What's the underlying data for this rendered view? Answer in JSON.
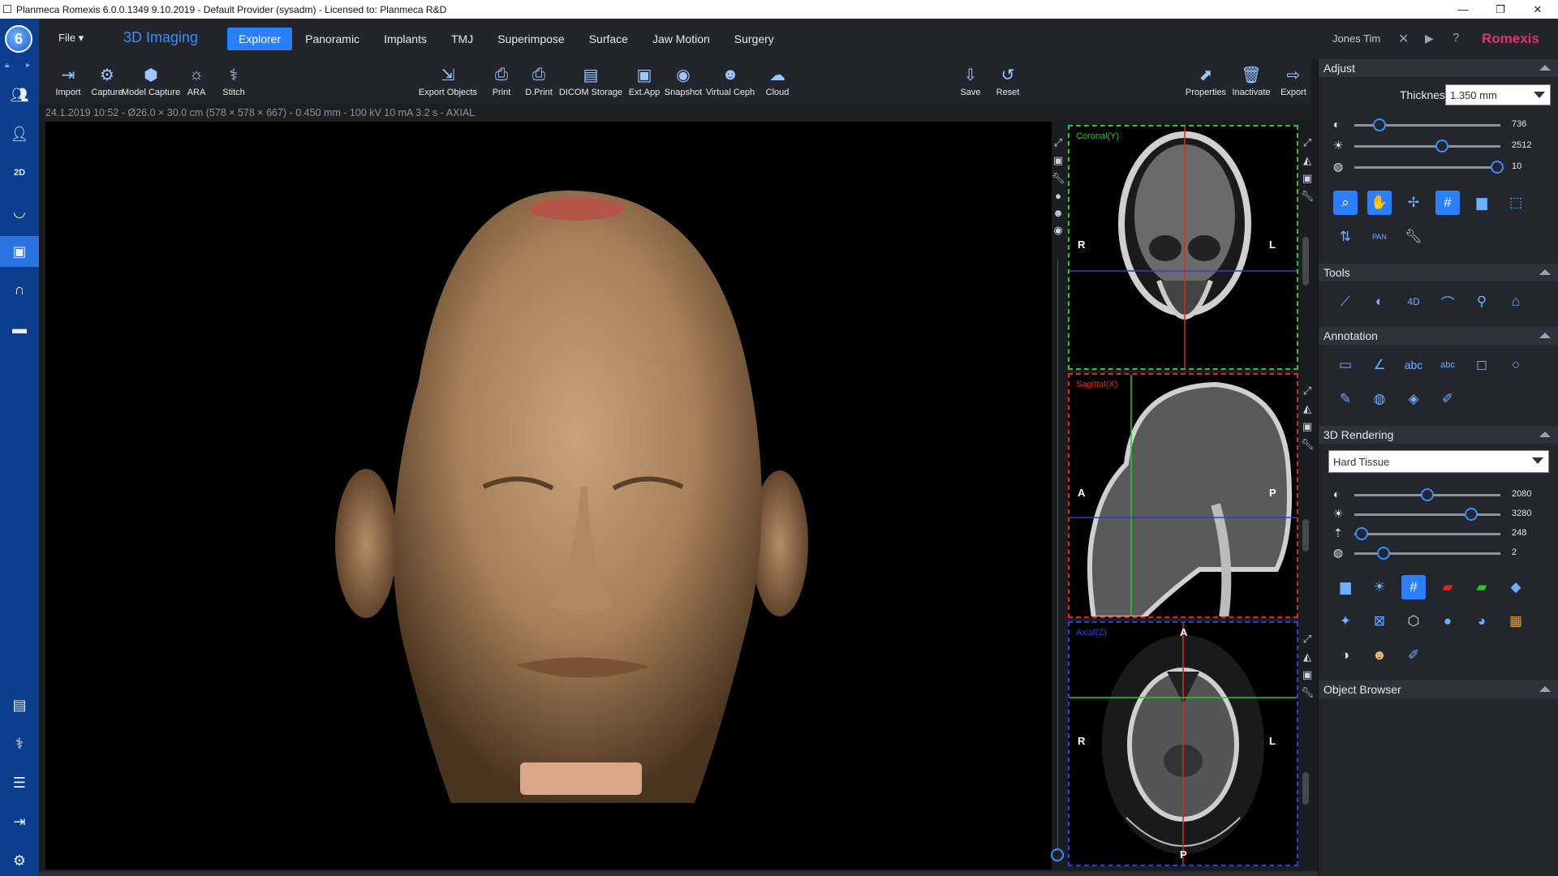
{
  "titlebar": {
    "title": "Planmeca Romexis 6.0.0.1349 9.10.2019 - Default Provider (sysadm) - Licensed to: Planmeca R&D",
    "minimize": "—",
    "maximize": "❐",
    "close": "✕"
  },
  "menubar": {
    "file": "File",
    "mode_title": "3D Imaging",
    "tabs": [
      "Explorer",
      "Panoramic",
      "Implants",
      "TMJ",
      "Superimpose",
      "Surface",
      "Jaw Motion",
      "Surgery"
    ],
    "active_tab": "Explorer",
    "user": "Jones  Tim",
    "brand": "Romexis"
  },
  "toolbar": {
    "left": [
      {
        "label": "Import",
        "icon": "import-icon"
      },
      {
        "label": "Capture",
        "icon": "capture-icon"
      },
      {
        "label": "Model Capture",
        "icon": "model-capture-icon"
      },
      {
        "label": "ARA",
        "icon": "ara-icon"
      },
      {
        "label": "Stitch",
        "icon": "stitch-icon"
      }
    ],
    "middle": [
      {
        "label": "Export Objects",
        "icon": "export-objects-icon"
      },
      {
        "label": "Print",
        "icon": "print-icon"
      },
      {
        "label": "D.Print",
        "icon": "dprint-icon"
      },
      {
        "label": "DICOM Storage",
        "icon": "dicom-storage-icon"
      },
      {
        "label": "Ext.App",
        "icon": "ext-app-icon"
      },
      {
        "label": "Snapshot",
        "icon": "snapshot-icon"
      },
      {
        "label": "Virtual Ceph",
        "icon": "virtual-ceph-icon"
      },
      {
        "label": "Cloud",
        "icon": "cloud-icon"
      }
    ],
    "save": [
      {
        "label": "Save",
        "icon": "save-icon"
      },
      {
        "label": "Reset",
        "icon": "reset-icon"
      }
    ],
    "right": [
      {
        "label": "Properties",
        "icon": "properties-icon"
      },
      {
        "label": "Inactivate",
        "icon": "inactivate-icon"
      },
      {
        "label": "Export",
        "icon": "export-icon"
      }
    ]
  },
  "info_line": "24.1.2019 10:52 - Ø26.0 × 30.0 cm (578 × 578 × 667) - 0.450 mm - 100 kV 10 mA 3.2 s - AXIAL",
  "slices": {
    "coronal": {
      "label": "Coronal(Y)",
      "left": "R",
      "right": "L",
      "color": "#22cc22"
    },
    "sagittal": {
      "label": "Sagittal(X)",
      "left": "A",
      "right": "P",
      "color": "#e02424"
    },
    "axial": {
      "label": "Axial(Z)",
      "top": "A",
      "bottom": "P",
      "left": "R",
      "right": "L",
      "color": "#2a3fe0"
    }
  },
  "panel": {
    "adjust": {
      "title": "Adjust",
      "thickness_label": "Thickness",
      "thickness_value": "1.350 mm",
      "sliders": [
        {
          "icon": "contrast-icon",
          "value": "736",
          "pos": 0.17
        },
        {
          "icon": "brightness-icon",
          "value": "2512",
          "pos": 0.6
        },
        {
          "icon": "sharpness-icon",
          "value": "10",
          "pos": 0.98
        }
      ]
    },
    "tools": {
      "title": "Tools"
    },
    "annotation": {
      "title": "Annotation"
    },
    "rendering": {
      "title": "3D Rendering",
      "preset": "Hard Tissue",
      "sliders": [
        {
          "icon": "contrast-icon",
          "value": "2080",
          "pos": 0.5
        },
        {
          "icon": "brightness-icon",
          "value": "3280",
          "pos": 0.8
        },
        {
          "icon": "threshold-icon",
          "value": "248",
          "pos": 0.05
        },
        {
          "icon": "sharpness-icon",
          "value": "2",
          "pos": 0.2
        }
      ]
    },
    "object_browser": {
      "title": "Object Browser"
    }
  },
  "colors": {
    "accent": "#2a7fff",
    "brand": "#e0336b",
    "dock": "#0d3d8f"
  }
}
